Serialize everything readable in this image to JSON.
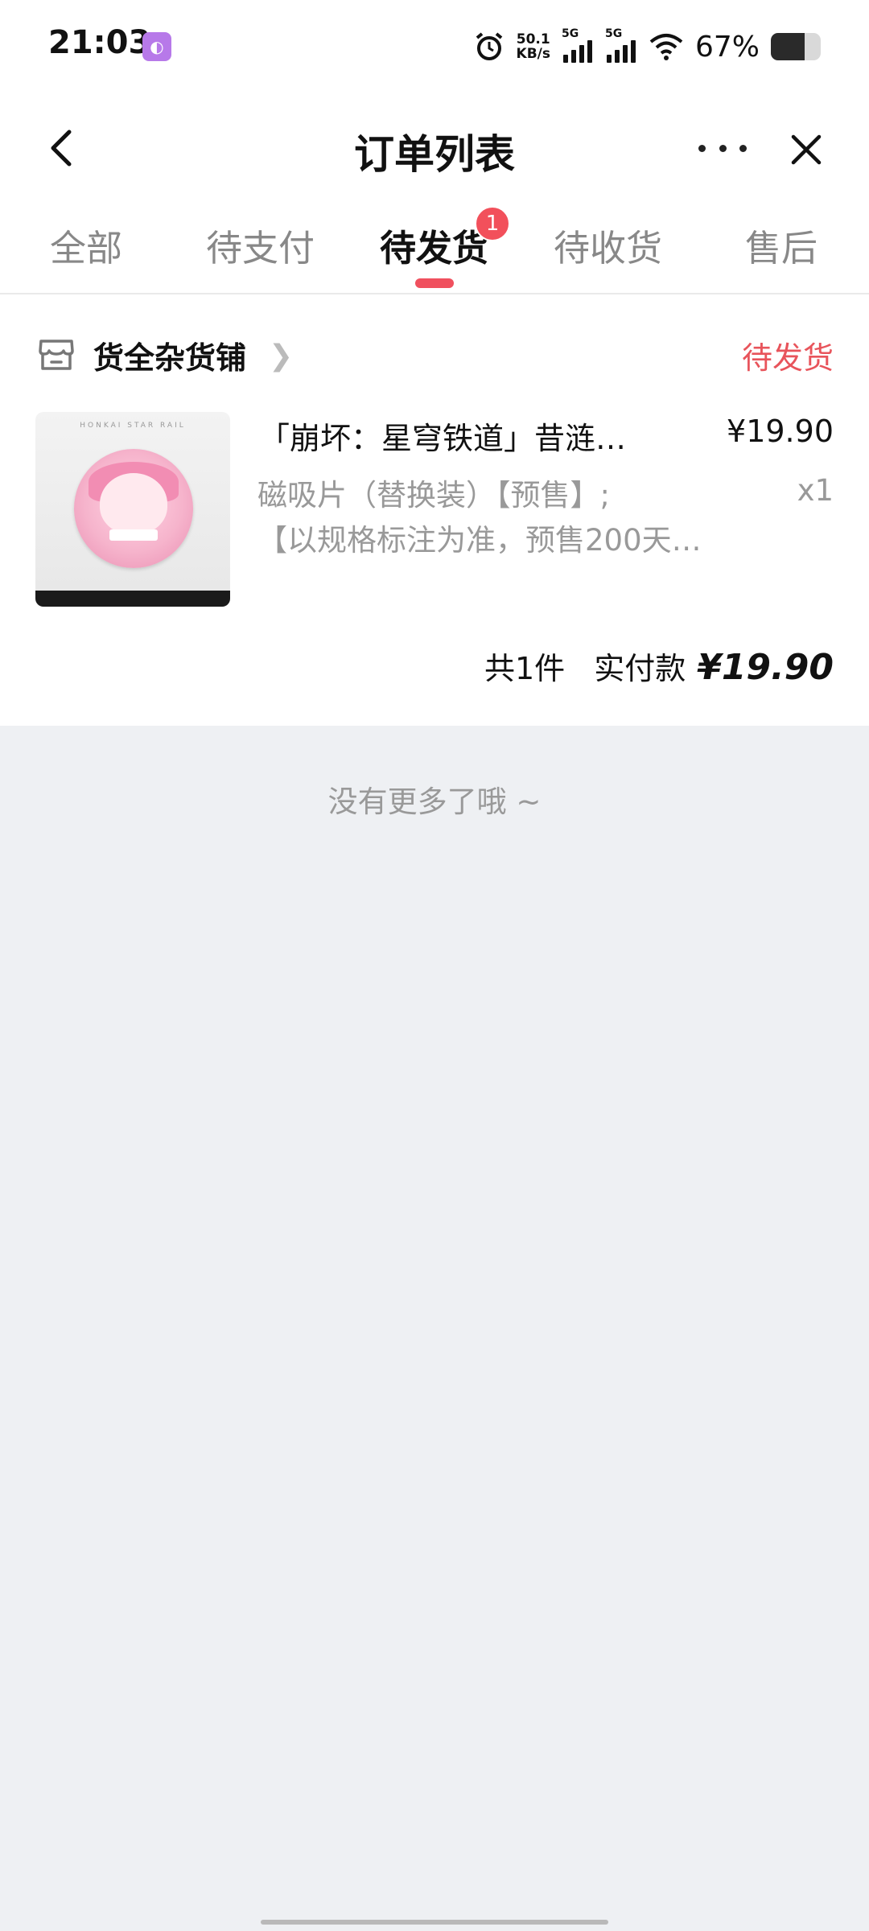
{
  "status_bar": {
    "time": "21:03",
    "netspeed_value": "50.1",
    "netspeed_unit": "KB/s",
    "signal1_label": "5G",
    "signal2_label": "5G",
    "battery_text": "67%",
    "battery_level": 0.67,
    "icons": [
      "app-notification-icon",
      "alarm-icon",
      "signal-icon",
      "signal-icon",
      "wifi-icon",
      "battery-icon"
    ]
  },
  "header": {
    "title": "订单列表",
    "icons": [
      "back-icon",
      "more-icon",
      "close-icon"
    ]
  },
  "tabs": [
    {
      "label": "全部",
      "active": false
    },
    {
      "label": "待支付",
      "active": false
    },
    {
      "label": "待发货",
      "active": true,
      "badge": "1"
    },
    {
      "label": "待收货",
      "active": false
    },
    {
      "label": "售后",
      "active": false
    }
  ],
  "order": {
    "store_name": "货全杂货铺",
    "status": "待发货",
    "product_title": "「崩坏：星穹铁道」昔涟…",
    "price": "¥19.90",
    "spec_line1": "磁吸片（替换装）【预售】;",
    "spec_line2": "【以规格标注为准，预售200天…",
    "quantity": "x1",
    "count_text": "共1件",
    "paid_label": "实付款",
    "paid_amount": "¥19.90",
    "accent_color": "#e8545b"
  },
  "footer": {
    "no_more_text": "没有更多了哦 ~"
  }
}
